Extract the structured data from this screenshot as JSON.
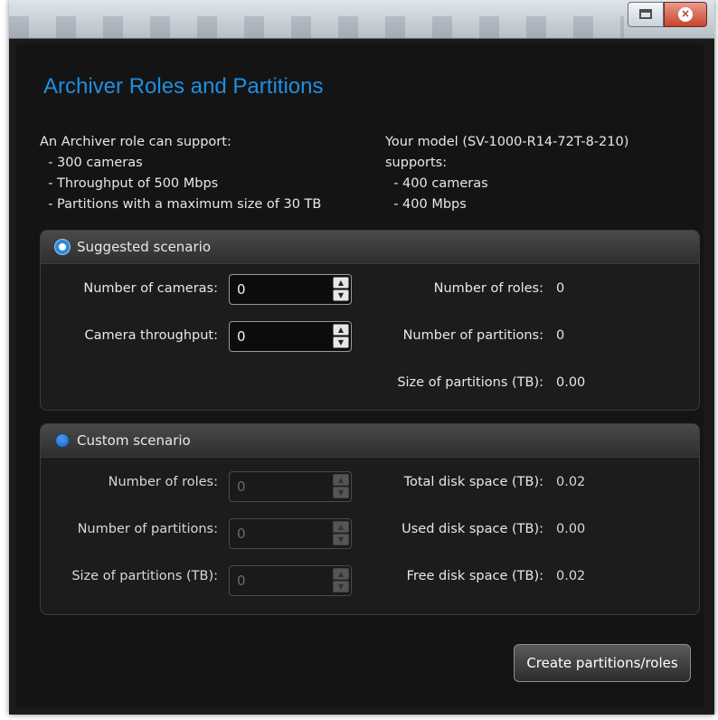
{
  "window": {
    "maximize_label": "",
    "close_glyph": "×"
  },
  "header": {
    "title": "Archiver Roles and Partitions"
  },
  "info": {
    "left": [
      "An Archiver role can support:",
      "  - 300 cameras",
      "  - Throughput of 500 Mbps",
      "  - Partitions with a maximum size of 30 TB"
    ],
    "right": [
      "Your model (SV-1000-R14-72T-8-210)",
      "supports:",
      "  - 400 cameras",
      "  - 400 Mbps"
    ]
  },
  "suggested": {
    "label": "Suggested scenario",
    "selected": true,
    "cameras_label": "Number of cameras:",
    "cameras_value": "0",
    "throughput_label": "Camera throughput:",
    "throughput_value": "0",
    "roles_label": "Number of roles:",
    "roles_value": "0",
    "partitions_label": "Number of partitions:",
    "partitions_value": "0",
    "size_label": "Size of partitions (TB):",
    "size_value": "0.00"
  },
  "custom": {
    "label": "Custom scenario",
    "selected": false,
    "roles_label": "Number of roles:",
    "roles_value": "0",
    "partitions_label": "Number of partitions:",
    "partitions_value": "0",
    "size_label": "Size of partitions (TB):",
    "size_value": "0",
    "total_label": "Total disk space (TB):",
    "total_value": "0.02",
    "used_label": "Used disk space (TB):",
    "used_value": "0.00",
    "free_label": "Free disk space (TB):",
    "free_value": "0.02"
  },
  "actions": {
    "create_label": "Create partitions/roles"
  },
  "colors": {
    "title_blue": "#1f8fe0",
    "background": "#141414",
    "close_red": "#c6452f"
  }
}
